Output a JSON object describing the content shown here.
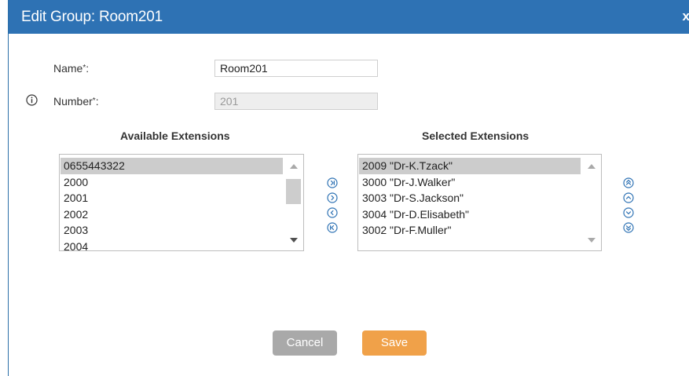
{
  "dialog": {
    "title": "Edit Group: Room201",
    "close_label": "x"
  },
  "form": {
    "name_label": "Name",
    "name_value": "Room201",
    "number_label": "Number",
    "number_value": "201",
    "required_mark": "*",
    "colon": ":"
  },
  "available": {
    "heading": "Available Extensions",
    "items": [
      "0655443322",
      "2000",
      "2001",
      "2002",
      "2003",
      "2004"
    ]
  },
  "selected": {
    "heading": "Selected Extensions",
    "items": [
      "2009 \"Dr-K.Tzack\"",
      "3000 \"Dr-J.Walker\"",
      "3003 \"Dr-S.Jackson\"",
      "3004 \"Dr-D.Elisabeth\"",
      "3002 \"Dr-F.Muller\""
    ]
  },
  "transfer_icons": [
    "move-all-right-icon",
    "move-right-icon",
    "move-left-icon",
    "move-all-left-icon"
  ],
  "order_icons": [
    "move-top-icon",
    "move-up-icon",
    "move-down-icon",
    "move-bottom-icon"
  ],
  "buttons": {
    "cancel": "Cancel",
    "save": "Save"
  },
  "colors": {
    "titlebar": "#2e72b4",
    "save": "#f0a149",
    "cancel": "#a9a9a9",
    "icon": "#2e72b4"
  }
}
